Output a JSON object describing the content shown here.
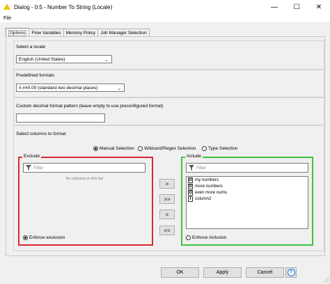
{
  "window": {
    "title": "Dialog - 0:5 - Number To String (Locale)",
    "icon": "warning-triangle-icon",
    "minimize_glyph": "—",
    "maximize_glyph": "☐",
    "close_glyph": "✕"
  },
  "menu": {
    "file": "File"
  },
  "tabs": [
    {
      "label": "Options",
      "active": true
    },
    {
      "label": "Flow Variables",
      "active": false
    },
    {
      "label": "Memory Policy",
      "active": false
    },
    {
      "label": "Job Manager Selection",
      "active": false
    }
  ],
  "locale": {
    "label": "Select a locale",
    "value": "English (United States)"
  },
  "formats": {
    "label": "Predefined formats",
    "value": "#,##0.00 (standard two decimal places)"
  },
  "custom_pattern": {
    "label": "Custom decimal format pattern (leave empty to use preconfigured format)",
    "value": ""
  },
  "columns": {
    "label": "Select columns to format",
    "modes": [
      {
        "label": "Manual Selection",
        "selected": true
      },
      {
        "label": "Wildcard/Regex Selection",
        "selected": false
      },
      {
        "label": "Type Selection",
        "selected": false
      }
    ],
    "exclude": {
      "title": "Exclude",
      "filter_placeholder": "Filter",
      "empty_message": "No columns in this list",
      "enforce_label": "Enforce exclusion",
      "enforce_selected": true,
      "border_color": "#d9282f"
    },
    "include": {
      "title": "Include",
      "filter_placeholder": "Filter",
      "enforce_label": "Enforce inclusion",
      "enforce_selected": false,
      "border_color": "#3cc43c",
      "items": [
        {
          "type": "D",
          "name": "my numbers"
        },
        {
          "type": "D",
          "name": "more numbers"
        },
        {
          "type": "D",
          "name": "even more nums"
        },
        {
          "type": "I",
          "name": "column2"
        }
      ]
    },
    "move_buttons": [
      ">",
      ">>",
      "<",
      "<<"
    ]
  },
  "buttons": {
    "ok": "OK",
    "apply": "Apply",
    "cancel": "Cancel",
    "help": "?"
  },
  "colors": {
    "window_bg": "#f0f0f0",
    "exclude_border": "#d9282f",
    "include_border": "#3cc43c",
    "help_blue": "#1a6fd1"
  }
}
